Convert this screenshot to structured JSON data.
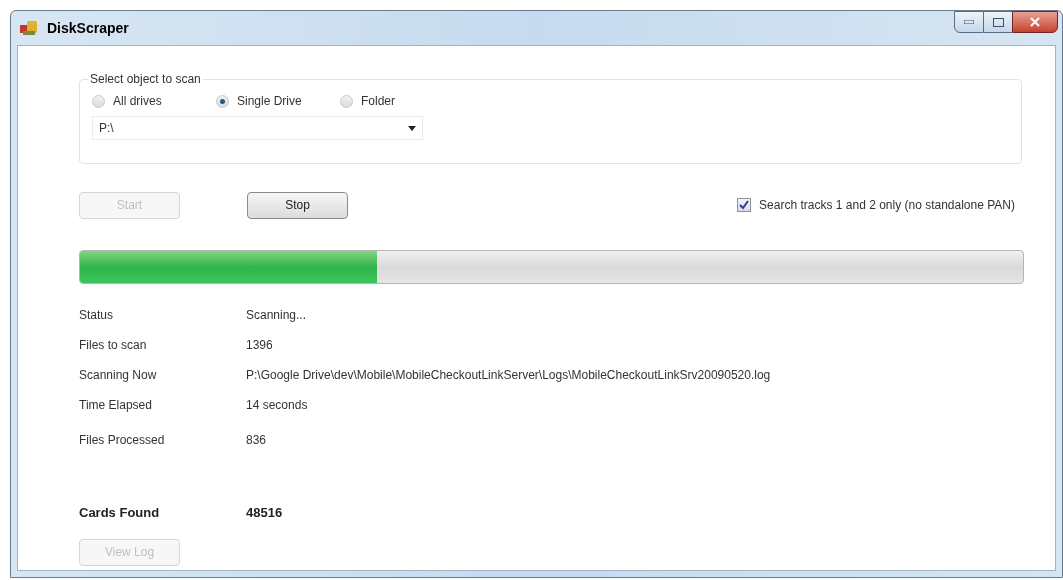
{
  "window": {
    "title": "DiskScraper"
  },
  "scan_group": {
    "title": "Select object to scan",
    "options": [
      {
        "label": "All drives",
        "selected": false
      },
      {
        "label": "Single Drive",
        "selected": true
      },
      {
        "label": "Folder",
        "selected": false
      }
    ],
    "drive": {
      "value": "P:\\"
    }
  },
  "buttons": [
    {
      "label": "Start",
      "disabled": true
    },
    {
      "label": "Stop",
      "disabled": false
    }
  ],
  "tracks_option": {
    "label": "Search tracks 1 and 2 only (no standalone PAN)",
    "checked": true
  },
  "progress": {
    "level": 0.315
  },
  "info": [
    {
      "label": "Status",
      "value": "Scanning..."
    },
    {
      "label": "Files to scan",
      "value": "1396"
    },
    {
      "label": "Scanning Now",
      "value": "P:\\Google Drive\\dev\\Mobile\\MobileCheckoutLinkServer\\Logs\\MobileCheckoutLinkSrv20090520.log"
    },
    {
      "label": "Time Elapsed",
      "value": "14 seconds"
    },
    {
      "label": "Files Processed",
      "value": "836"
    }
  ],
  "cards_found": {
    "label": "Cards Found",
    "value": "48516"
  },
  "view_log": {
    "label": "View Log",
    "disabled": true
  }
}
